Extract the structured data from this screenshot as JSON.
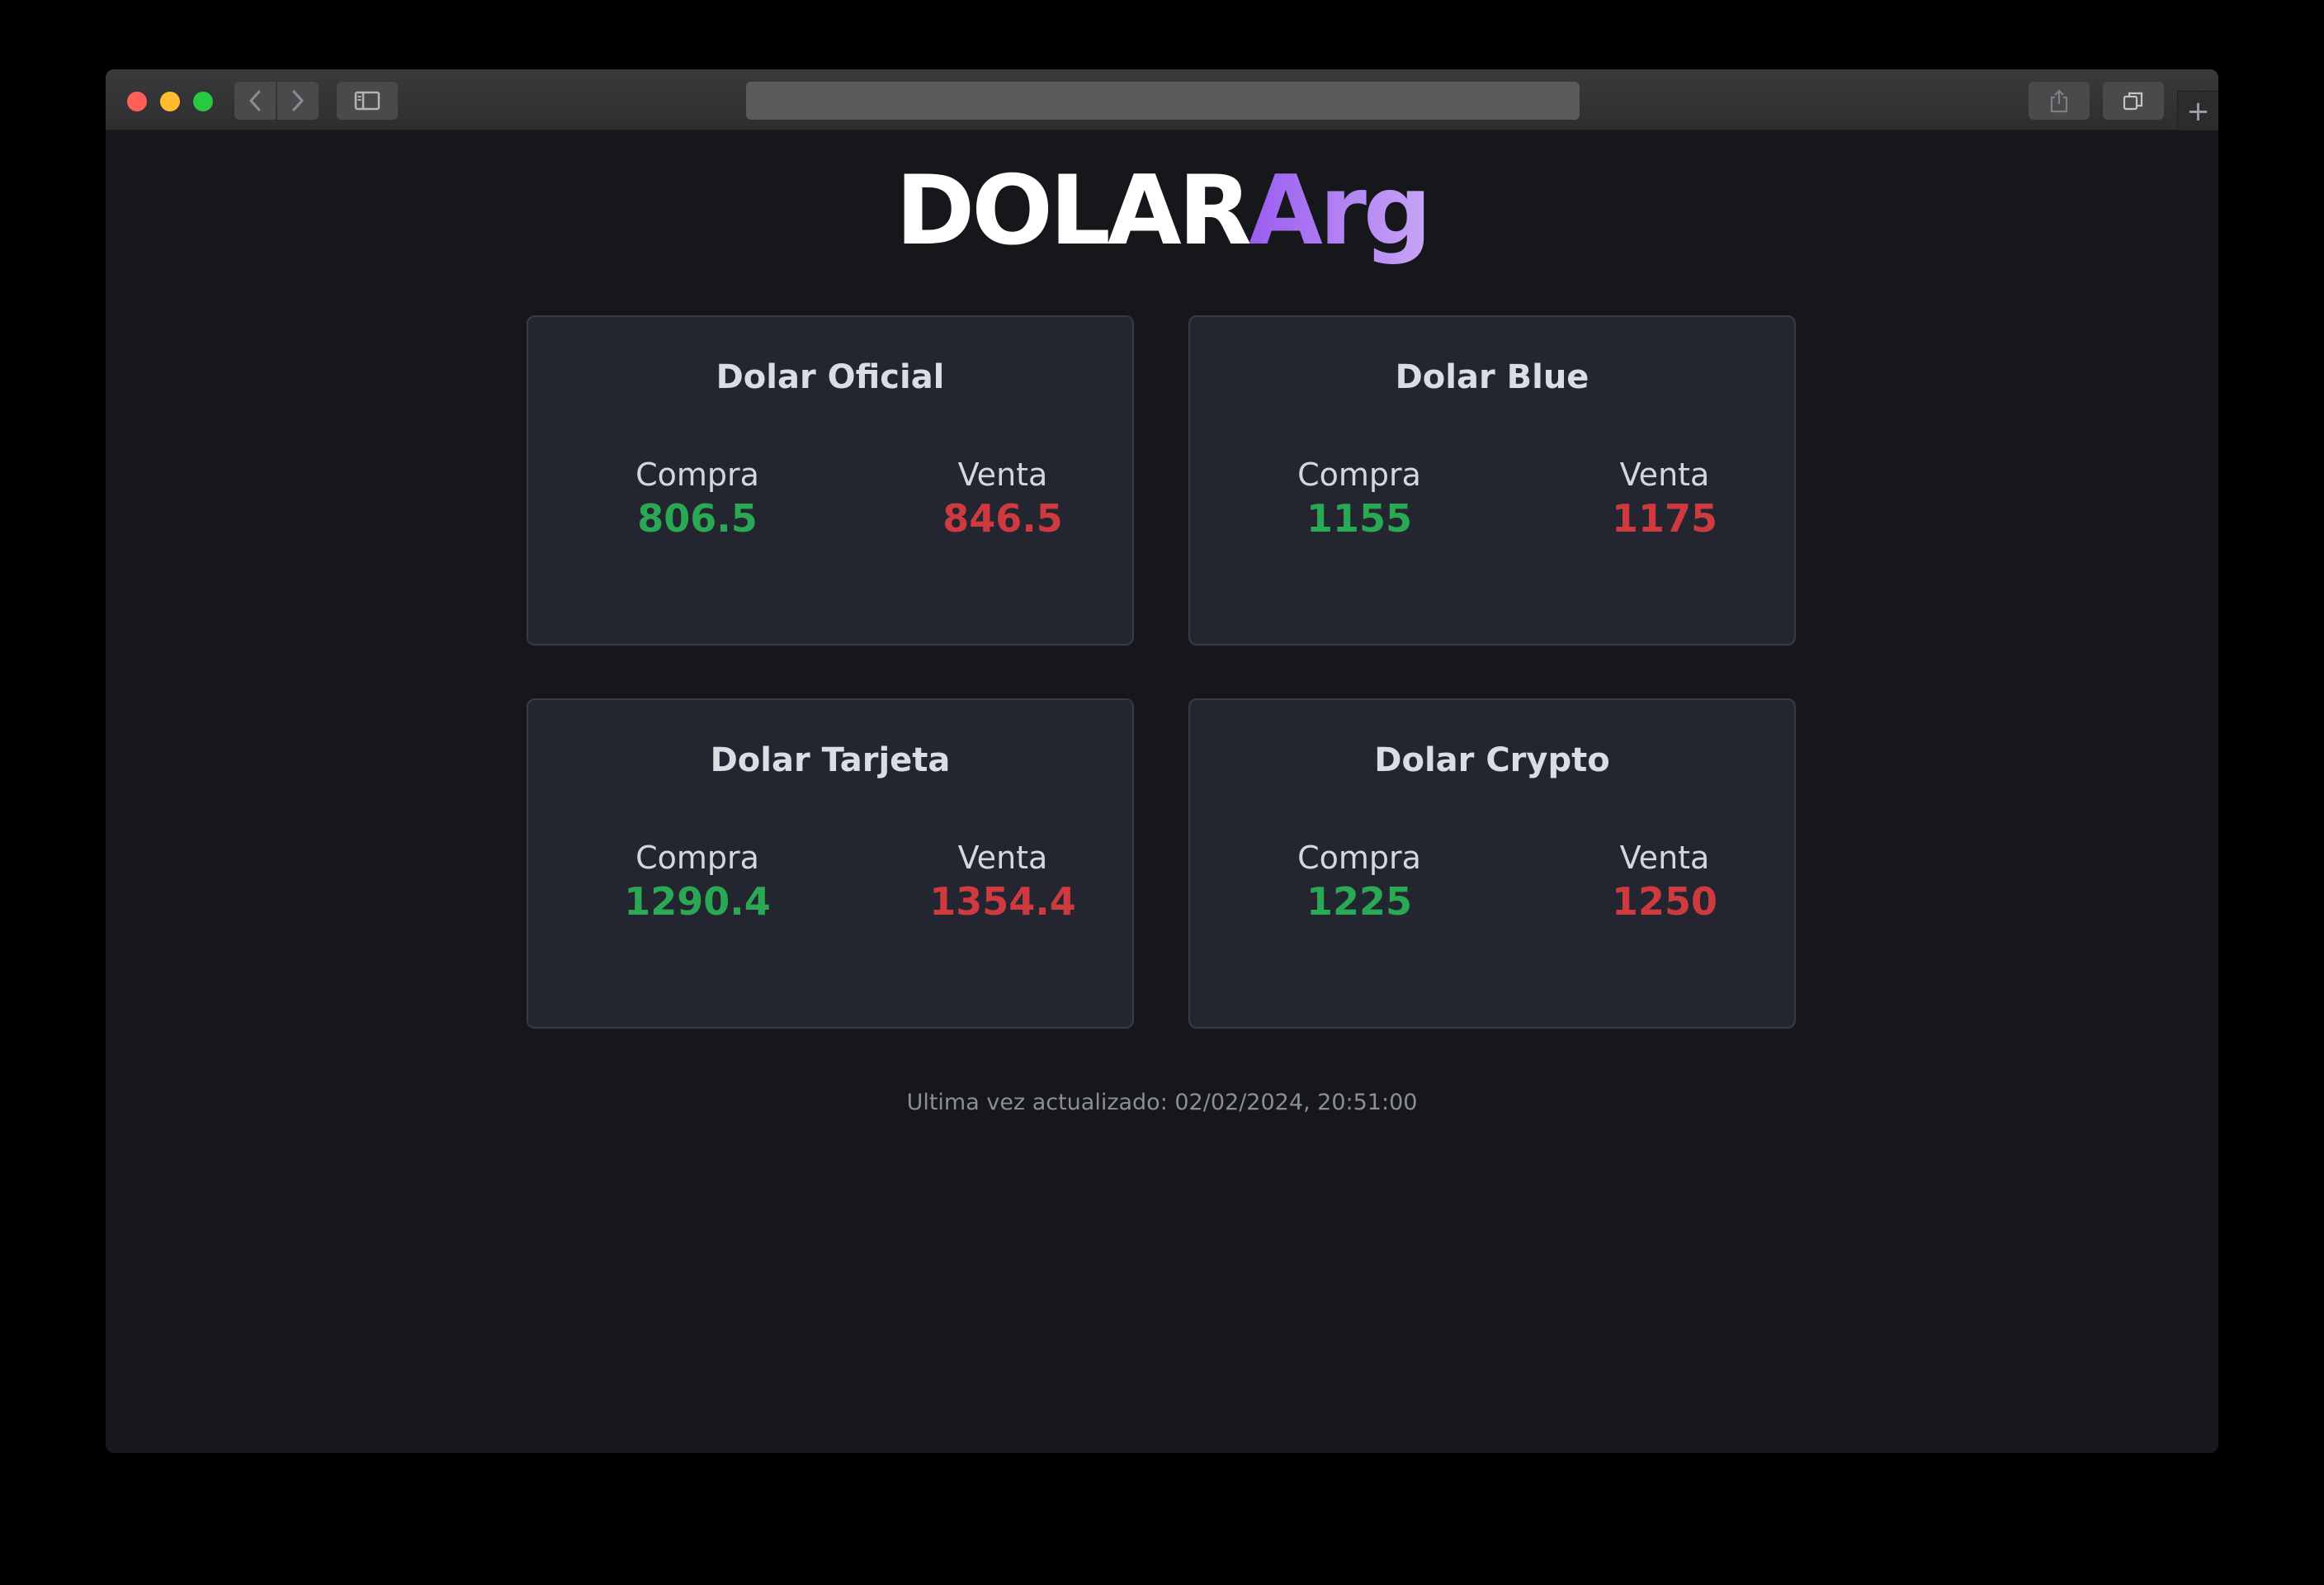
{
  "brand": {
    "main": "DOLAR",
    "accent": "Arg"
  },
  "browser": {
    "back_icon": "‹",
    "forward_icon": "›",
    "new_tab_icon": "+"
  },
  "cards": [
    {
      "title": "Dolar Oficial",
      "buy_label": "Compra",
      "buy_value": "806.5",
      "sell_label": "Venta",
      "sell_value": "846.5"
    },
    {
      "title": "Dolar Blue",
      "buy_label": "Compra",
      "buy_value": "1155",
      "sell_label": "Venta",
      "sell_value": "1175"
    },
    {
      "title": "Dolar Tarjeta",
      "buy_label": "Compra",
      "buy_value": "1290.4",
      "sell_label": "Venta",
      "sell_value": "1354.4"
    },
    {
      "title": "Dolar Crypto",
      "buy_label": "Compra",
      "buy_value": "1225",
      "sell_label": "Venta",
      "sell_value": "1250"
    }
  ],
  "footer": {
    "updated": "Ultima vez actualizado: 02/02/2024, 20:51:00"
  },
  "colors": {
    "buy": "#2aa853",
    "sell": "#cf3a3f",
    "accent_start": "#9a5cf0",
    "accent_end": "#c7a6f5"
  }
}
